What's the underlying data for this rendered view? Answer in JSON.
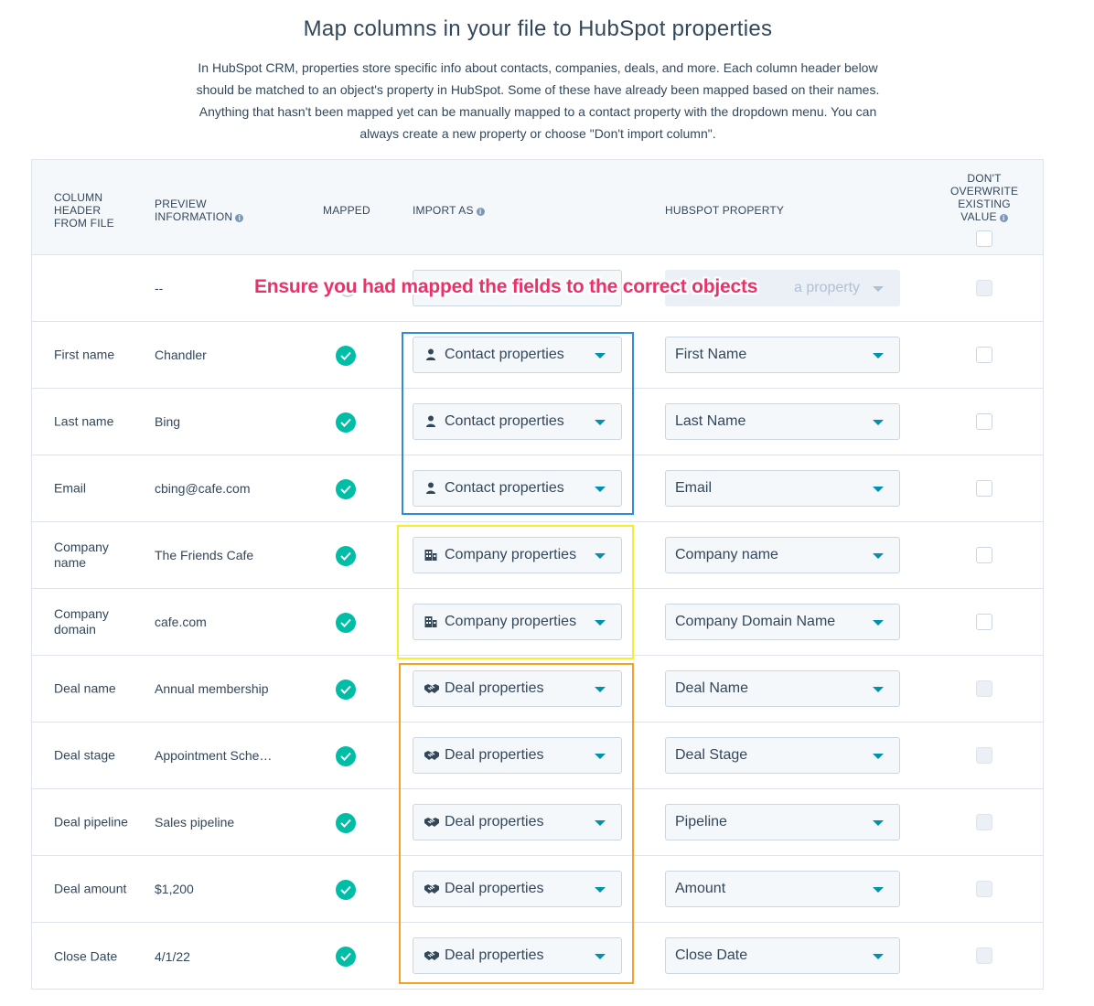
{
  "page": {
    "title": "Map columns in your file to HubSpot properties",
    "description": "In HubSpot CRM, properties store specific info about contacts, companies, deals, and more. Each column header below should be matched to an object's property in HubSpot. Some of these have already been mapped based on their names. Anything that hasn't been mapped yet can be manually mapped to a contact property with the dropdown menu. You can always create a new property or choose \"Don't import column\"."
  },
  "table": {
    "headers": {
      "column_header": "COLUMN HEADER FROM FILE",
      "preview": "PREVIEW INFORMATION",
      "mapped": "MAPPED",
      "import_as": "IMPORT AS",
      "hubspot_property": "HUBSPOT PROPERTY",
      "dont_overwrite": "DON'T OVERWRITE EXISTING VALUE"
    },
    "first_row": {
      "column": "",
      "preview": "--",
      "import_as": "",
      "property": "a property"
    },
    "rows": [
      {
        "column": "First name",
        "preview": "Chandler",
        "import_as": "Contact properties",
        "icon": "contact-icon",
        "property": "First Name",
        "mapped": true,
        "checkbox_enabled": true
      },
      {
        "column": "Last name",
        "preview": "Bing",
        "import_as": "Contact properties",
        "icon": "contact-icon",
        "property": "Last Name",
        "mapped": true,
        "checkbox_enabled": true
      },
      {
        "column": "Email",
        "preview": "cbing@cafe.com",
        "import_as": "Contact properties",
        "icon": "contact-icon",
        "property": "Email",
        "mapped": true,
        "checkbox_enabled": true
      },
      {
        "column": "Company name",
        "preview": "The Friends Cafe",
        "import_as": "Company properties",
        "icon": "company-icon",
        "property": "Company name",
        "mapped": true,
        "checkbox_enabled": true
      },
      {
        "column": "Company domain",
        "preview": "cafe.com",
        "import_as": "Company properties",
        "icon": "company-icon",
        "property": "Company Domain Name",
        "mapped": true,
        "checkbox_enabled": true
      },
      {
        "column": "Deal name",
        "preview": "Annual membership",
        "import_as": "Deal properties",
        "icon": "deal-icon",
        "property": "Deal Name",
        "mapped": true,
        "checkbox_enabled": false
      },
      {
        "column": "Deal stage",
        "preview": "Appointment Sche…",
        "import_as": "Deal properties",
        "icon": "deal-icon",
        "property": "Deal Stage",
        "mapped": true,
        "checkbox_enabled": false
      },
      {
        "column": "Deal pipeline",
        "preview": "Sales pipeline",
        "import_as": "Deal properties",
        "icon": "deal-icon",
        "property": "Pipeline",
        "mapped": true,
        "checkbox_enabled": false
      },
      {
        "column": "Deal amount",
        "preview": "$1,200",
        "import_as": "Deal properties",
        "icon": "deal-icon",
        "property": "Amount",
        "mapped": true,
        "checkbox_enabled": false
      },
      {
        "column": "Close Date",
        "preview": "4/1/22",
        "import_as": "Deal properties",
        "icon": "deal-icon",
        "property": "Close Date",
        "mapped": true,
        "checkbox_enabled": false
      }
    ]
  },
  "annotation": {
    "text": "Ensure you had mapped the fields to the correct objects",
    "color": "#e8336a"
  },
  "highlight_colors": {
    "contact": "#2b8ce0",
    "company": "#f5ee2a",
    "deal": "#f5a02a"
  },
  "colors": {
    "check": "#00bda5",
    "caret": "#0091ae",
    "text": "#33475b"
  }
}
